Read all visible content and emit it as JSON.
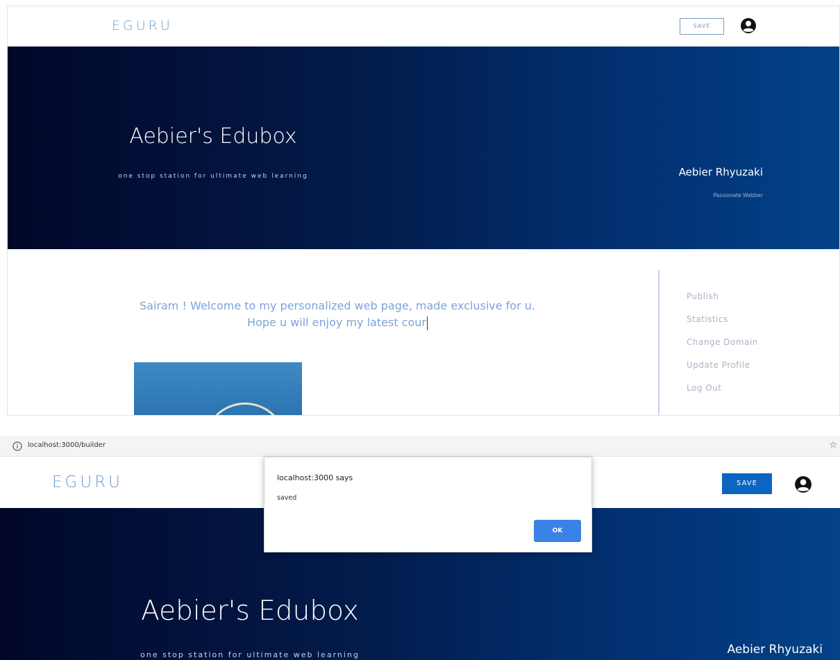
{
  "top": {
    "nav": {
      "brand": "EGURU",
      "save_label": "SAVE"
    },
    "hero": {
      "title": "Aebier's Edubox",
      "subtitle": "one stop station for ultimate web learning",
      "name": "Aebier Rhyuzaki",
      "role": "Passionate Webber"
    },
    "welcome": {
      "line1": "Sairam ! Welcome to my personalized web page, made exclusive for u.",
      "line2": "Hope u will enjoy my latest cour"
    },
    "menu": {
      "items": [
        {
          "label": "Publish"
        },
        {
          "label": "Statistics"
        },
        {
          "label": "Change Domain"
        },
        {
          "label": "Update Profile"
        },
        {
          "label": "Log Out"
        }
      ]
    }
  },
  "bottom": {
    "browser": {
      "url": "localhost:3000/builder"
    },
    "nav": {
      "brand": "EGURU",
      "save_label": "SAVE"
    },
    "hero": {
      "title": "Aebier's Edubox",
      "subtitle": "one stop station for ultimate web learning",
      "name": "Aebier Rhyuzaki"
    },
    "dialog": {
      "title": "localhost:3000 says",
      "message": "saved",
      "ok_label": "OK"
    }
  },
  "colors": {
    "brand": "#6f9bd1",
    "save_primary": "#0a66c2",
    "hero_dark": "#02072a",
    "hero_light": "#034288",
    "ok_button": "#3b82e6"
  },
  "icons": [
    "user-circle-icon",
    "info-icon",
    "star-icon"
  ]
}
